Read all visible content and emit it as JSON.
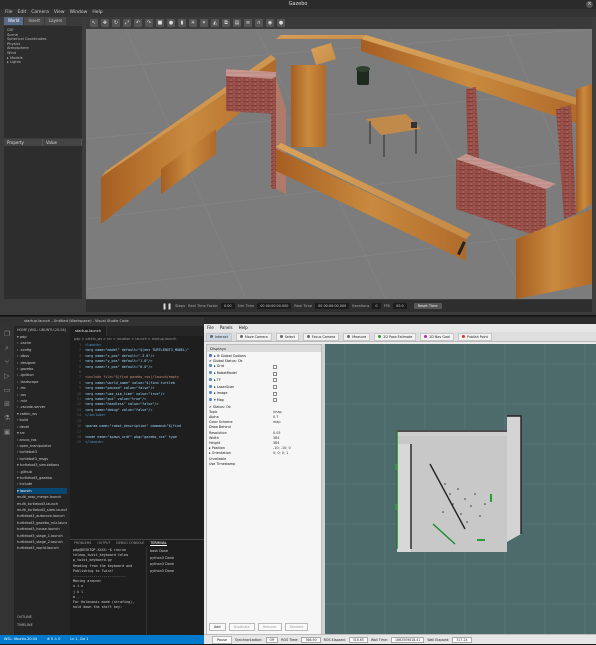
{
  "gazebo": {
    "title": "Gazebo",
    "menu": [
      "File",
      "Edit",
      "Camera",
      "View",
      "Window",
      "Help"
    ],
    "left_tabs": [
      "World",
      "Insert",
      "Layers"
    ],
    "world_tree": [
      "GUI",
      "Scene",
      "Spherical Coordinates",
      "Physics",
      "Atmosphere",
      "Wind",
      "▸ Models",
      "▸ Lights"
    ],
    "property_headers": [
      "Property",
      "Value"
    ],
    "status": {
      "play_icon": "pause-icon",
      "steps_label": "Steps",
      "rtf_label": "Real Time Factor",
      "rtf_value": "0.00",
      "sim_time_label": "Sim Time",
      "sim_time_value": "00 00:00:00.000",
      "real_time_label": "Real Time",
      "real_time_value": "00 00:00:00.000",
      "iterations_label": "Iterations",
      "iterations_value": "0",
      "fps_label": "FPS",
      "fps_value": "00.0",
      "reset_label": "Reset Time"
    }
  },
  "vscode": {
    "title": "startup.launch - Untitled (Workspace) - Visual Studio Code",
    "explorer_header": "HOME [WSL: UBUNTU-20.04]",
    "explorer_items": [
      {
        "label": "▾ pdp",
        "sel": false
      },
      {
        "label": "  › .cache",
        "sel": false
      },
      {
        "label": "  › .config",
        "sel": false
      },
      {
        "label": "  › .dbus",
        "sel": false
      },
      {
        "label": "  › .designer",
        "sel": false
      },
      {
        "label": "  › .gazebo",
        "sel": false
      },
      {
        "label": "  › .ignition",
        "sel": false
      },
      {
        "label": "  › .landscape",
        "sel": false
      },
      {
        "label": "  › .mc",
        "sel": false
      },
      {
        "label": "  › .ros",
        "sel": false
      },
      {
        "label": "  › .rviz",
        "sel": false
      },
      {
        "label": "  › .vscode-server",
        "sel": false
      },
      {
        "label": "  ▾ catkin_ws",
        "sel": false
      },
      {
        "label": "    › build",
        "sel": false
      },
      {
        "label": "    › devel",
        "sel": false
      },
      {
        "label": "    ▾ src",
        "sel": false
      },
      {
        "label": "      › aruco_ros",
        "sel": false
      },
      {
        "label": "      › open_manipulator",
        "sel": false
      },
      {
        "label": "      › turtlebot3",
        "sel": false
      },
      {
        "label": "      › turtlebot3_msgs",
        "sel": false
      },
      {
        "label": "      ▾ turtlebot3_simulations",
        "sel": false
      },
      {
        "label": "        › .github",
        "sel": false
      },
      {
        "label": "        ▾ turtlebot3_gazebo",
        "sel": false
      },
      {
        "label": "          › include",
        "sel": false
      },
      {
        "label": "          ▾ launch",
        "sel": true
      },
      {
        "label": "            multi_map_merge.launch",
        "sel": false
      },
      {
        "label": "            multi_turtlebot3.launch",
        "sel": false
      },
      {
        "label": "            multi_turtlebot3_slam.launch",
        "sel": false
      },
      {
        "label": "            turtlebot3_autorace.launch",
        "sel": false
      },
      {
        "label": "            turtlebot3_gazebo_rviz.launch",
        "sel": false
      },
      {
        "label": "            turtlebot3_house.launch",
        "sel": false
      },
      {
        "label": "            turtlebot3_stage_1.launch",
        "sel": false
      },
      {
        "label": "            turtlebot3_stage_2.launch",
        "sel": false
      },
      {
        "label": "            turtlebot3_world.launch",
        "sel": false
      }
    ],
    "explorer_footer": [
      "OUTLINE",
      "TIMELINE"
    ],
    "tab_label": "startup.launch",
    "breadcrumb": "pdp > catkin_ws > src > location > launch > startup.launch",
    "code": [
      {
        "ln": "1",
        "text": "<launch>",
        "kind": "tag"
      },
      {
        "ln": "2",
        "text": "  <arg name=\"model\" default=\"$(env TURTLEBOT3_MODEL)\"",
        "kind": "code"
      },
      {
        "ln": "3",
        "text": "  <arg name=\"x_pos\" default=\"-3.0\"/>",
        "kind": "code"
      },
      {
        "ln": "4",
        "text": "  <arg name=\"y_pos\" default=\"1.0\"/>",
        "kind": "code"
      },
      {
        "ln": "5",
        "text": "  <arg name=\"z_pos\" default=\"0.0\"/>",
        "kind": "code"
      },
      {
        "ln": "6",
        "text": "",
        "kind": "code"
      },
      {
        "ln": "7",
        "text": "  <include file=\"$(find gazebo_ros)/launch/empty",
        "kind": "str"
      },
      {
        "ln": "8",
        "text": "    <arg name=\"world_name\" value=\"$(find turtleb",
        "kind": "code"
      },
      {
        "ln": "9",
        "text": "    <arg name=\"paused\" value=\"false\"/>",
        "kind": "code"
      },
      {
        "ln": "10",
        "text": "    <arg name=\"use_sim_time\" value=\"true\"/>",
        "kind": "code"
      },
      {
        "ln": "11",
        "text": "    <arg name=\"gui\" value=\"true\"/>",
        "kind": "code"
      },
      {
        "ln": "12",
        "text": "    <arg name=\"headless\" value=\"false\"/>",
        "kind": "code"
      },
      {
        "ln": "13",
        "text": "    <arg name=\"debug\" value=\"false\"/>",
        "kind": "code"
      },
      {
        "ln": "14",
        "text": "  </include>",
        "kind": "tag"
      },
      {
        "ln": "15",
        "text": "",
        "kind": "code"
      },
      {
        "ln": "16",
        "text": "  <param name=\"robot_description\" command=\"$(find",
        "kind": "code"
      },
      {
        "ln": "17",
        "text": "",
        "kind": "code"
      },
      {
        "ln": "18",
        "text": "  <node name=\"spawn_urdf\" pkg=\"gazebo_ros\" type",
        "kind": "code"
      },
      {
        "ln": "19",
        "text": "</launch>",
        "kind": "tag"
      }
    ],
    "panel_tabs": [
      "PROBLEMS",
      "OUTPUT",
      "DEBUG CONSOLE",
      "TERMINAL"
    ],
    "terminal_lines": [
      "pdp@DESKTOP-XXXX:~$ rosrun",
      " teleop_twist_keyboard teleo",
      "p_twist_keyboard.py",
      "",
      "Reading from the keyboard  and",
      " Publishing to Twist!",
      "--------------------------",
      "Moving around:",
      "   u    i    o",
      "   j    k    l",
      "   m    ,    .",
      "",
      "For Holonomic mode (strafing),",
      " hold down the shift key:"
    ],
    "terminal_list": [
      "bash Done",
      "python3 Done",
      "python3 Done",
      "python3 Done"
    ],
    "statusbar": [
      "WSL: Ubuntu-20.04",
      "⊗ 0  ⚠ 0",
      "Ln 1, Col 1"
    ]
  },
  "rviz": {
    "menu": [
      "File",
      "Panels",
      "Help"
    ],
    "tools": [
      {
        "label": "Interact",
        "color": "#6a6a6a",
        "active": true
      },
      {
        "label": "Move Camera",
        "color": "#6a6a6a",
        "active": false
      },
      {
        "label": "Select",
        "color": "#6a6a6a",
        "active": false
      },
      {
        "label": "Focus Camera",
        "color": "#6a6a6a",
        "active": false
      },
      {
        "label": "Measure",
        "color": "#6a6a6a",
        "active": false
      },
      {
        "label": "2D Pose Estimate",
        "color": "#2e9b2e",
        "active": false
      },
      {
        "label": "2D Nav Goal",
        "color": "#b02e9b",
        "active": false
      },
      {
        "label": "Publish Point",
        "color": "#d23b2b",
        "active": false
      }
    ],
    "displays_header": "Displays",
    "tree": [
      {
        "name": "▸ ⚙ Global Options",
        "val": "",
        "icon": "#4a78c8",
        "check": false
      },
      {
        "name": "  ✔ Global Status: Ok",
        "val": "",
        "icon": "",
        "check": false
      },
      {
        "name": "▸ Grid",
        "val": "",
        "icon": "#5b8ccc",
        "check": true
      },
      {
        "name": "▸ RobotModel",
        "val": "",
        "icon": "#5b8ccc",
        "check": true
      },
      {
        "name": "▸ TF",
        "val": "",
        "icon": "#5b8ccc",
        "check": true
      },
      {
        "name": "▸ LaserScan",
        "val": "",
        "icon": "#5b8ccc",
        "check": true
      },
      {
        "name": "▸ Image",
        "val": "",
        "icon": "#5b8ccc",
        "check": true
      },
      {
        "name": "▾ Map",
        "val": "",
        "icon": "#5b8ccc",
        "check": true
      },
      {
        "name": "    ✔ Status: Ok",
        "val": "",
        "icon": "",
        "check": false
      },
      {
        "name": "    Topic",
        "val": "/map",
        "icon": "",
        "check": false
      },
      {
        "name": "    Alpha",
        "val": "0.7",
        "icon": "",
        "check": false
      },
      {
        "name": "    Color Scheme",
        "val": "map",
        "icon": "",
        "check": false
      },
      {
        "name": "    Draw Behind",
        "val": "",
        "icon": "",
        "check": false
      },
      {
        "name": "    Resolution",
        "val": "0.05",
        "icon": "",
        "check": false
      },
      {
        "name": "    Width",
        "val": "384",
        "icon": "",
        "check": false
      },
      {
        "name": "    Height",
        "val": "384",
        "icon": "",
        "check": false
      },
      {
        "name": "  ▸ Position",
        "val": "-10; -10; 0",
        "icon": "",
        "check": false
      },
      {
        "name": "  ▸ Orientation",
        "val": "0; 0; 0; 1",
        "icon": "",
        "check": false
      },
      {
        "name": "    Unreliable",
        "val": "",
        "icon": "",
        "check": false
      },
      {
        "name": "    Use Timestamp",
        "val": "",
        "icon": "",
        "check": false
      }
    ],
    "buttons": [
      {
        "label": "Add",
        "disabled": false
      },
      {
        "label": "Duplicate",
        "disabled": true
      },
      {
        "label": "Remove",
        "disabled": true
      },
      {
        "label": "Rename",
        "disabled": true
      }
    ],
    "time": {
      "header": "Time",
      "pause_label": "Pause",
      "sync_label": "Synchronization:",
      "sync_value": "Off",
      "ros_time_label": "ROS Time:",
      "ros_time_value": "366.90",
      "ros_elapsed_label": "ROS Elapsed:",
      "ros_elapsed_value": "316.65",
      "wall_time_label": "Wall Time:",
      "wall_time_value": "1662509818.41",
      "wall_elapsed_label": "Wall Elapsed:",
      "wall_elapsed_value": "317.24"
    }
  }
}
